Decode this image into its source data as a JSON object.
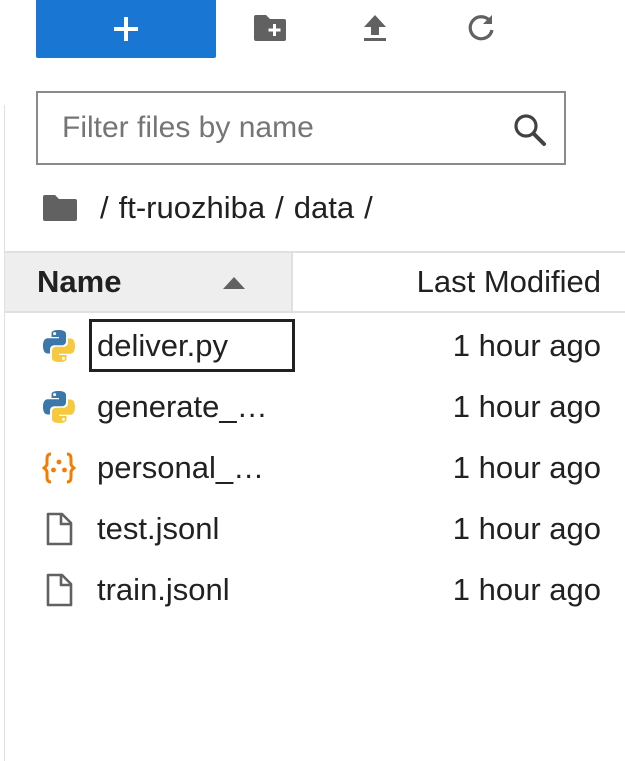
{
  "toolbar": {
    "new_button_icon": "plus-icon",
    "new_folder_icon": "new-folder-icon",
    "upload_icon": "upload-icon",
    "refresh_icon": "refresh-icon",
    "accent_color": "#1976d2"
  },
  "filter": {
    "placeholder": "Filter files by name",
    "value": "",
    "icon": "search-icon"
  },
  "breadcrumb": {
    "home_icon": "folder-icon",
    "sep1": "/",
    "crumb1": "ft-ruozhiba",
    "sep2": "/",
    "crumb2": "data",
    "sep3": "/"
  },
  "header": {
    "name": "Name",
    "modified": "Last Modified",
    "sort": "ascending"
  },
  "files": [
    {
      "name": "deliver.py",
      "modified": "1 hour ago",
      "icon": "python-icon",
      "focused": true
    },
    {
      "name": "generate_…",
      "modified": "1 hour ago",
      "icon": "python-icon",
      "focused": false
    },
    {
      "name": "personal_…",
      "modified": "1 hour ago",
      "icon": "json-icon",
      "focused": false
    },
    {
      "name": "test.jsonl",
      "modified": "1 hour ago",
      "icon": "file-icon",
      "focused": false
    },
    {
      "name": "train.jsonl",
      "modified": "1 hour ago",
      "icon": "file-icon",
      "focused": false
    }
  ]
}
